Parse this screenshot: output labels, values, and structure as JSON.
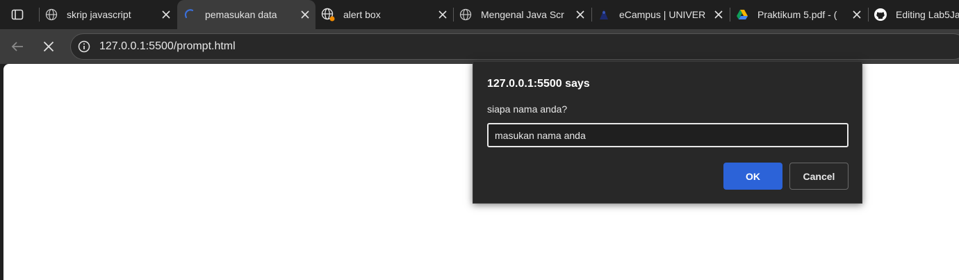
{
  "tabs": [
    {
      "label": "skrip javascript",
      "favicon": "globe-icon",
      "active": false,
      "has_close": true
    },
    {
      "label": "pemasukan data",
      "favicon": "loading-spinner-icon",
      "active": true,
      "has_close": true
    },
    {
      "label": "alert box",
      "favicon": "globe-icon",
      "active": false,
      "has_close": true,
      "badge_color": "#f28b00"
    },
    {
      "label": "Mengenal Java Scr",
      "favicon": "globe-icon",
      "active": false,
      "has_close": true
    },
    {
      "label": "eCampus | UNIVER",
      "favicon": "university-logo-icon",
      "active": false,
      "has_close": true
    },
    {
      "label": "Praktikum 5.pdf - (",
      "favicon": "google-drive-icon",
      "active": false,
      "has_close": true
    },
    {
      "label": "Editing Lab5Ja",
      "favicon": "github-icon",
      "active": false,
      "has_close": false
    }
  ],
  "toolbar": {
    "url": "127.0.0.1:5500/prompt.html"
  },
  "dialog": {
    "title": "127.0.0.1:5500 says",
    "message": "siapa nama anda?",
    "input_value": "masukan nama anda",
    "ok_label": "OK",
    "cancel_label": "Cancel"
  },
  "colors": {
    "accent": "#2c63d8",
    "tab_active_bg": "#3c3c3c",
    "frame_bg": "#1f1f1f",
    "dialog_bg": "#282828"
  }
}
